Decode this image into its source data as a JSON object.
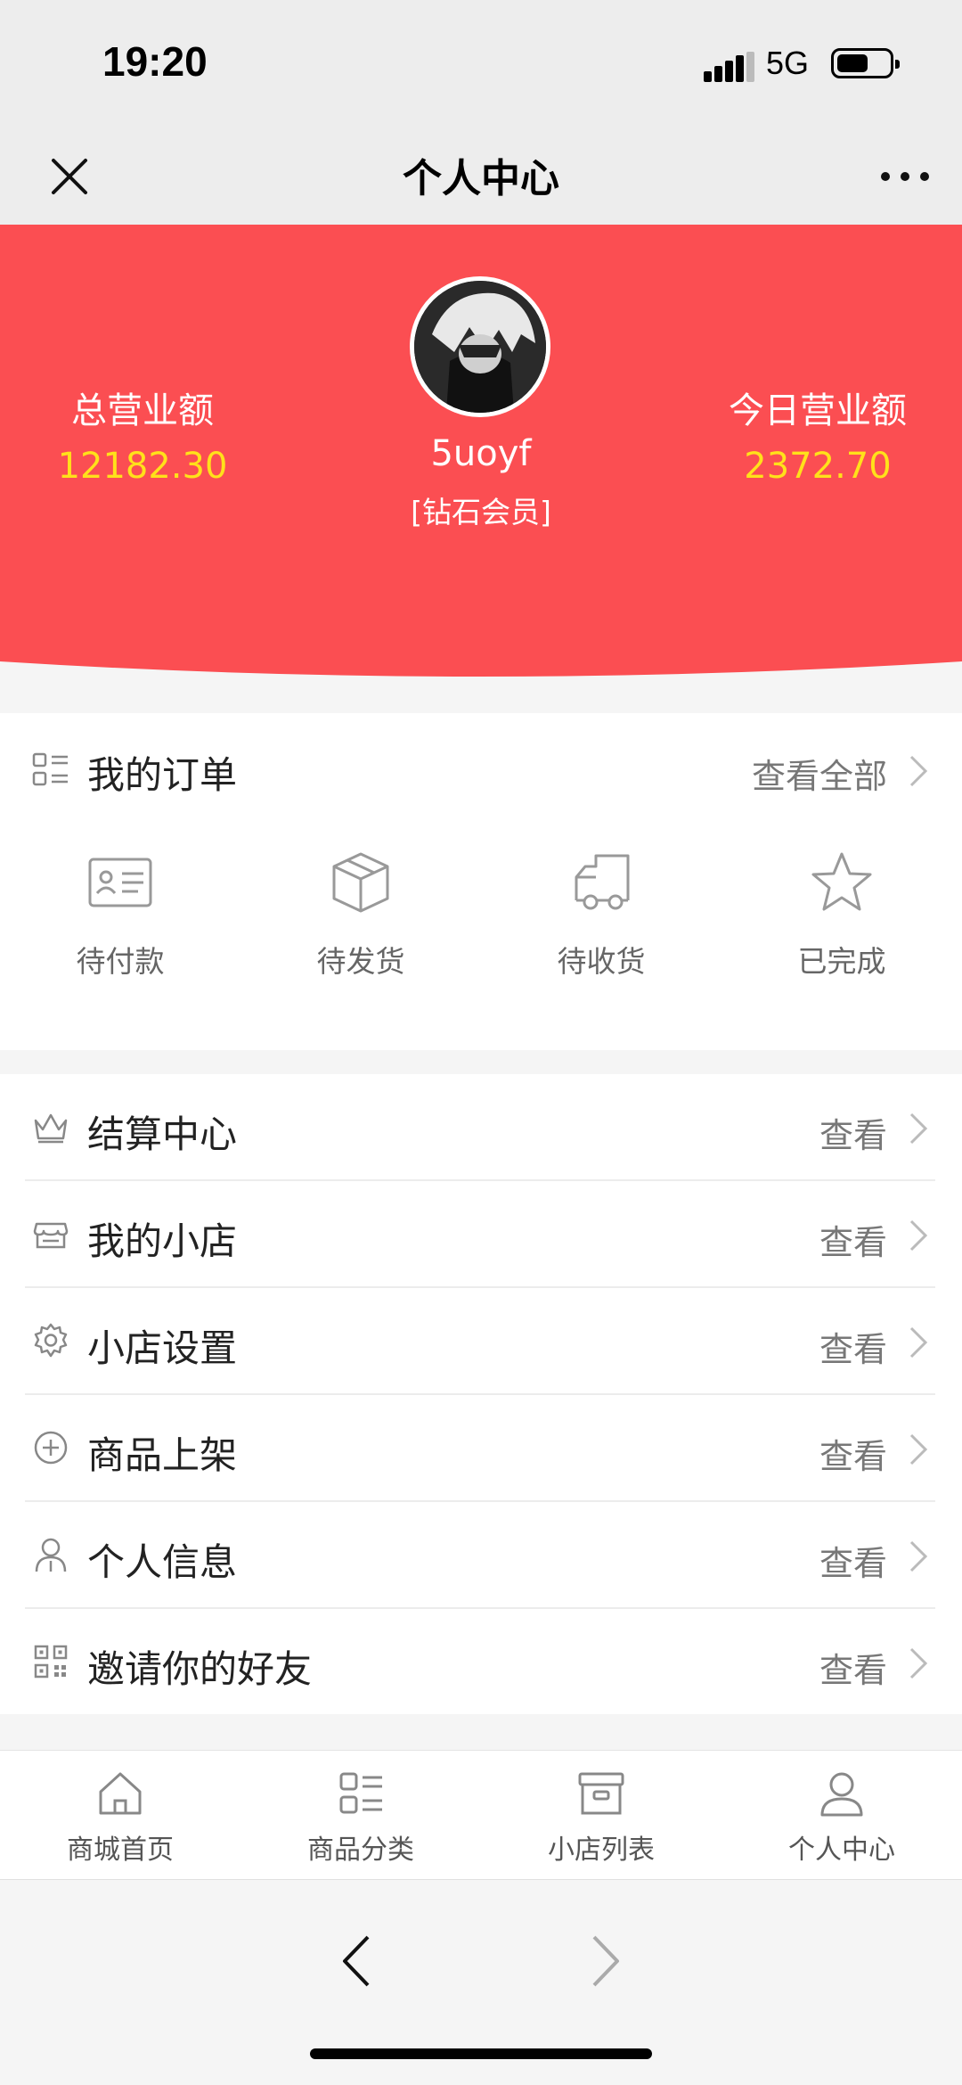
{
  "status_bar": {
    "time": "19:20",
    "network": "5G",
    "battery_level": 0.6
  },
  "nav": {
    "title": "个人中心",
    "close_icon": "close-icon",
    "more_icon": "more-icon"
  },
  "profile": {
    "username": "5uoyf",
    "level": "[钻石会员]",
    "total_label": "总营业额",
    "total_value": "12182.30",
    "today_label": "今日营业额",
    "today_value": "2372.70",
    "accent_color": "#fb4e52",
    "value_color": "#ffe11a"
  },
  "orders": {
    "title": "我的订单",
    "view_all": "查看全部",
    "items": [
      {
        "label": "待付款",
        "icon": "payment-card-icon"
      },
      {
        "label": "待发货",
        "icon": "package-box-icon"
      },
      {
        "label": "待收货",
        "icon": "delivery-truck-icon"
      },
      {
        "label": "已完成",
        "icon": "star-icon"
      }
    ]
  },
  "menu": {
    "items": [
      {
        "label": "结算中心",
        "action": "查看",
        "icon": "crown-icon"
      },
      {
        "label": "我的小店",
        "action": "查看",
        "icon": "shop-icon"
      },
      {
        "label": "小店设置",
        "action": "查看",
        "icon": "gear-icon"
      },
      {
        "label": "商品上架",
        "action": "查看",
        "icon": "plus-circle-icon"
      },
      {
        "label": "个人信息",
        "action": "查看",
        "icon": "user-icon"
      },
      {
        "label": "邀请你的好友",
        "action": "查看",
        "icon": "qrcode-icon"
      }
    ]
  },
  "tabbar": {
    "items": [
      {
        "label": "商城首页",
        "icon": "home-icon"
      },
      {
        "label": "商品分类",
        "icon": "category-icon"
      },
      {
        "label": "小店列表",
        "icon": "store-box-icon"
      },
      {
        "label": "个人中心",
        "icon": "user-icon"
      }
    ]
  },
  "browser": {
    "back_icon": "chevron-left-icon",
    "forward_icon": "chevron-right-icon"
  }
}
